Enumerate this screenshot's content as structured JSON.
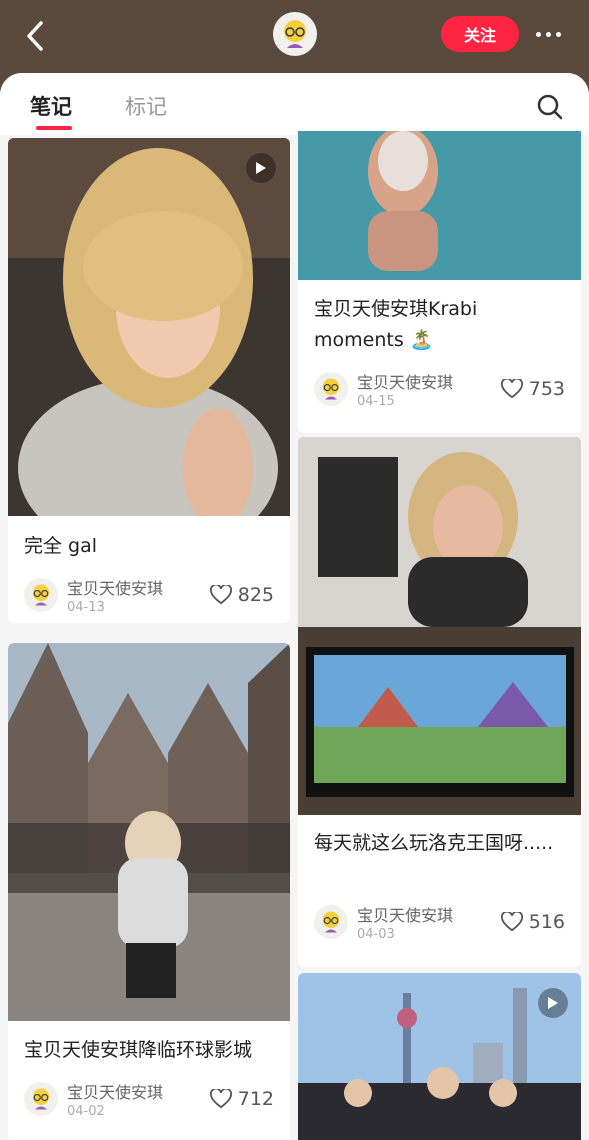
{
  "header": {
    "follow_label": "关注",
    "avatar_icon": "cartoon-avatar-icon",
    "back_icon": "chevron-left-icon",
    "more_icon": "more-dots-icon"
  },
  "tabs": {
    "notes": "笔记",
    "marks": "标记",
    "search_icon": "search-icon"
  },
  "colors": {
    "accent": "#ff2442",
    "header_bg": "#5a4a3e"
  },
  "notes": [
    {
      "title": "完全 gal",
      "author": "宝贝天使安琪",
      "date": "04-13",
      "likes": "825",
      "video": true
    },
    {
      "title": "宝贝天使安琪降临环球影城",
      "author": "宝贝天使安琪",
      "date": "04-02",
      "likes": "712",
      "video": false
    },
    {
      "title": "宝贝天使安琪Krabi moments 🏝️",
      "author": "宝贝天使安琪",
      "date": "04-15",
      "likes": "753",
      "video": false
    },
    {
      "title": "每天就这么玩洛克王国呀.....",
      "author": "宝贝天使安琪",
      "date": "04-03",
      "likes": "516",
      "video": false
    },
    {
      "title": "",
      "author": "",
      "date": "",
      "likes": "",
      "video": true
    }
  ]
}
